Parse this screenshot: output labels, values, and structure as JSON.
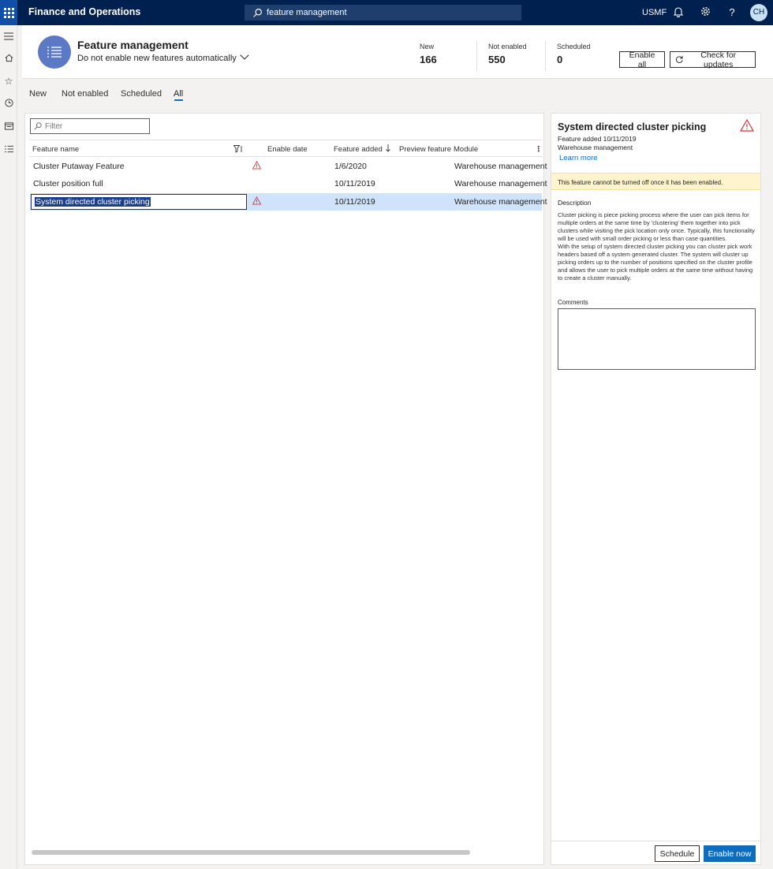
{
  "topbar": {
    "app_title": "Finance and Operations",
    "search_value": "feature management",
    "company": "USMF",
    "user_initials": "CH"
  },
  "header": {
    "title": "Feature management",
    "subtitle": "Do not enable new features automatically",
    "stats": [
      {
        "label": "New",
        "value": "166"
      },
      {
        "label": "Not enabled",
        "value": "550"
      },
      {
        "label": "Scheduled",
        "value": "0"
      }
    ],
    "enable_all_label": "Enable all",
    "check_updates_label": "Check for updates"
  },
  "tabs": [
    {
      "label": "New"
    },
    {
      "label": "Not enabled"
    },
    {
      "label": "Scheduled"
    },
    {
      "label": "All"
    }
  ],
  "active_tab": "All",
  "grid": {
    "filter_placeholder": "Filter",
    "columns": [
      "Feature name",
      "Enable date",
      "Feature added",
      "Preview feature",
      "Module"
    ],
    "rows": [
      {
        "name": "Cluster Putaway Feature",
        "warning": true,
        "enable_date": "",
        "added": "1/6/2020",
        "preview": "",
        "module": "Warehouse management"
      },
      {
        "name": "Cluster position full",
        "warning": false,
        "enable_date": "",
        "added": "10/11/2019",
        "preview": "",
        "module": "Warehouse management"
      },
      {
        "name": "System directed cluster picking",
        "warning": true,
        "enable_date": "",
        "added": "10/11/2019",
        "preview": "",
        "module": "Warehouse management"
      }
    ]
  },
  "detail": {
    "title": "System directed cluster picking",
    "feature_added": "Feature added 10/11/2019",
    "module": "Warehouse management",
    "learn_more": "Learn more",
    "note": "This feature cannot be turned off once it has been enabled.",
    "description_label": "Description",
    "description": "Cluster picking is piece picking process where the user can pick items for multiple orders at the same time by 'clustering' them together into pick clusters while visiting the pick location only once. Typically, this functionality will be used with small order picking or less than case quantities.\nWith the setup of system directed cluster picking you can cluster pick work headers based off a system generated cluster. The system will cluster up picking orders up to the number of positions specified on the cluster profile and allows the user to pick multiple orders at the same time without having to create a cluster manually.",
    "comments_label": "Comments",
    "schedule_label": "Schedule",
    "enable_now_label": "Enable now"
  },
  "colors": {
    "topbar": "#002050",
    "accent": "#0f6cbd",
    "selected_row": "#cfe4fa",
    "warning_note": "#fff4ce",
    "warning_icon": "#d13438"
  }
}
